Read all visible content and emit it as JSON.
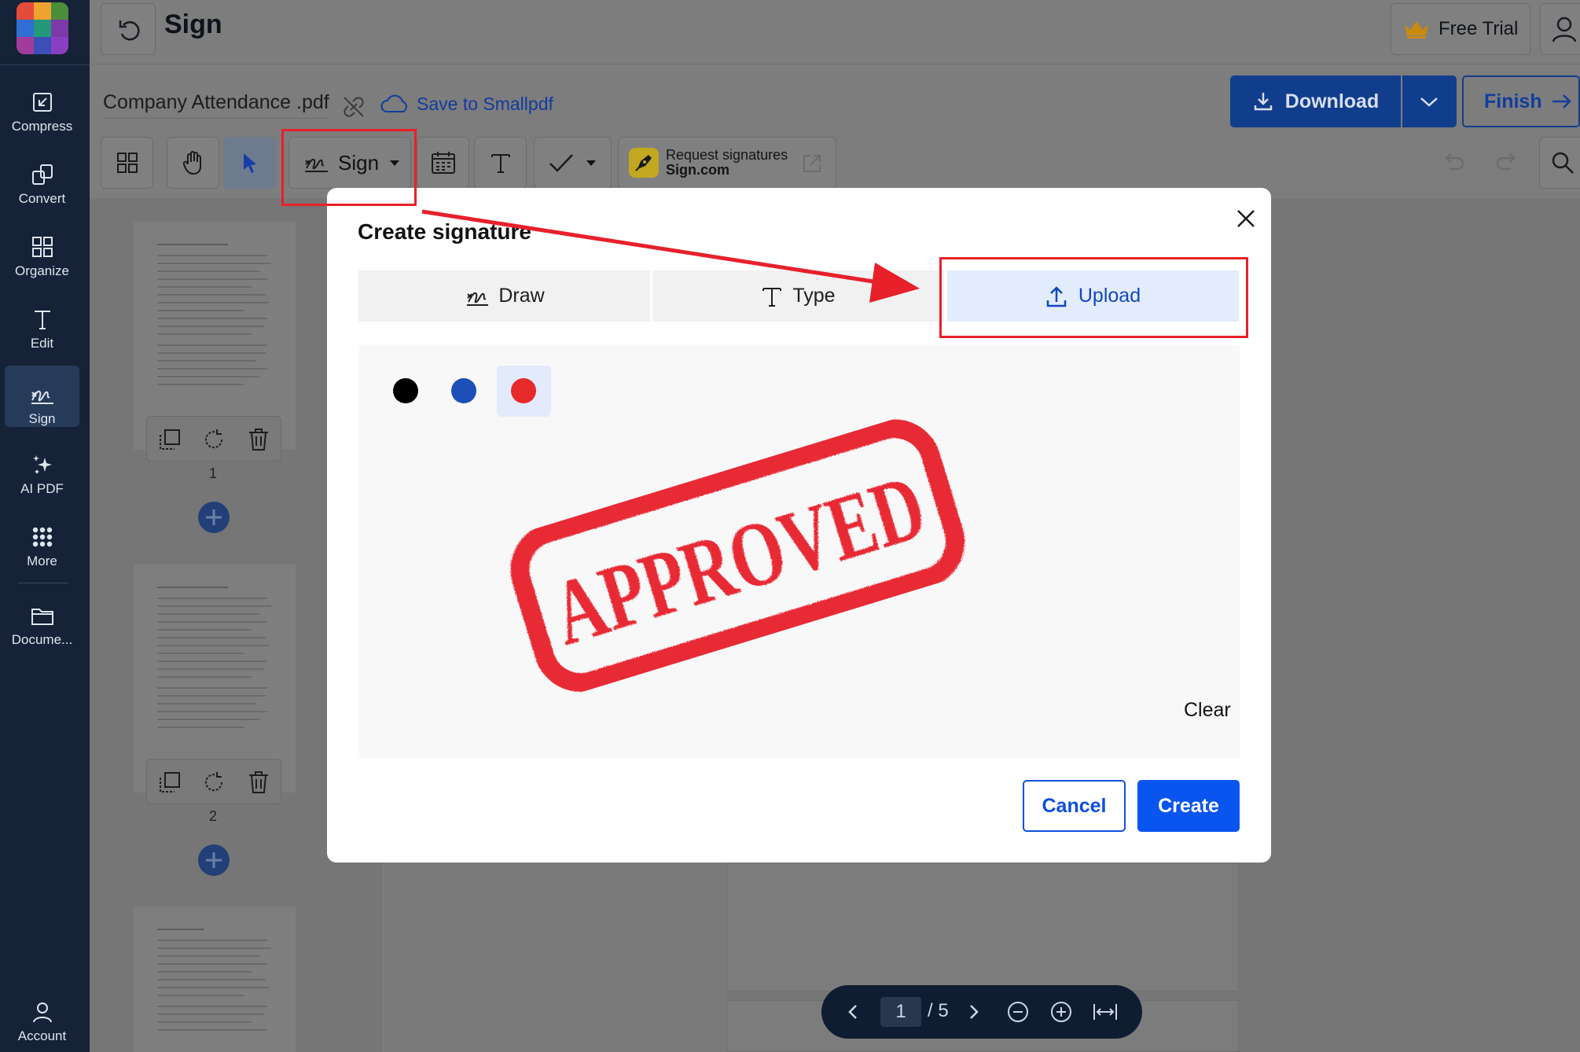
{
  "sidebar": {
    "items": [
      {
        "label": "Compress",
        "icon": "compress-icon"
      },
      {
        "label": "Convert",
        "icon": "convert-icon"
      },
      {
        "label": "Organize",
        "icon": "organize-icon"
      },
      {
        "label": "Edit",
        "icon": "edit-icon"
      },
      {
        "label": "Sign",
        "icon": "signature-icon"
      },
      {
        "label": "AI PDF",
        "icon": "sparkle-icon"
      },
      {
        "label": "More",
        "icon": "grid-dots-icon"
      },
      {
        "label": "Docume...",
        "icon": "folder-icon"
      },
      {
        "label": "Account",
        "icon": "account-icon"
      }
    ]
  },
  "header": {
    "title": "Sign",
    "free_trial": "Free Trial"
  },
  "file": {
    "name": "Company Attendance .pdf",
    "save_label": "Save to Smallpdf"
  },
  "actions": {
    "download": "Download",
    "finish": "Finish"
  },
  "toolbar": {
    "sign_label": "Sign",
    "request_line1": "Request signatures",
    "request_line2": "Sign.com"
  },
  "thumbnails": {
    "page_labels": [
      "1",
      "2"
    ]
  },
  "pager": {
    "current": "1",
    "total": "/ 5"
  },
  "modal": {
    "title": "Create signature",
    "tabs": [
      {
        "label": "Draw",
        "icon": "signature-icon"
      },
      {
        "label": "Type",
        "icon": "text-icon"
      },
      {
        "label": "Upload",
        "icon": "upload-icon"
      }
    ],
    "selected_tab": "Upload",
    "colors": [
      "#000000",
      "#1d4fb8",
      "#e82a2a"
    ],
    "selected_color": "#e82a2a",
    "stamp_text": "APPROVED",
    "clear": "Clear",
    "cancel": "Cancel",
    "create": "Create"
  },
  "annotation": {
    "color": "#e8202a"
  }
}
